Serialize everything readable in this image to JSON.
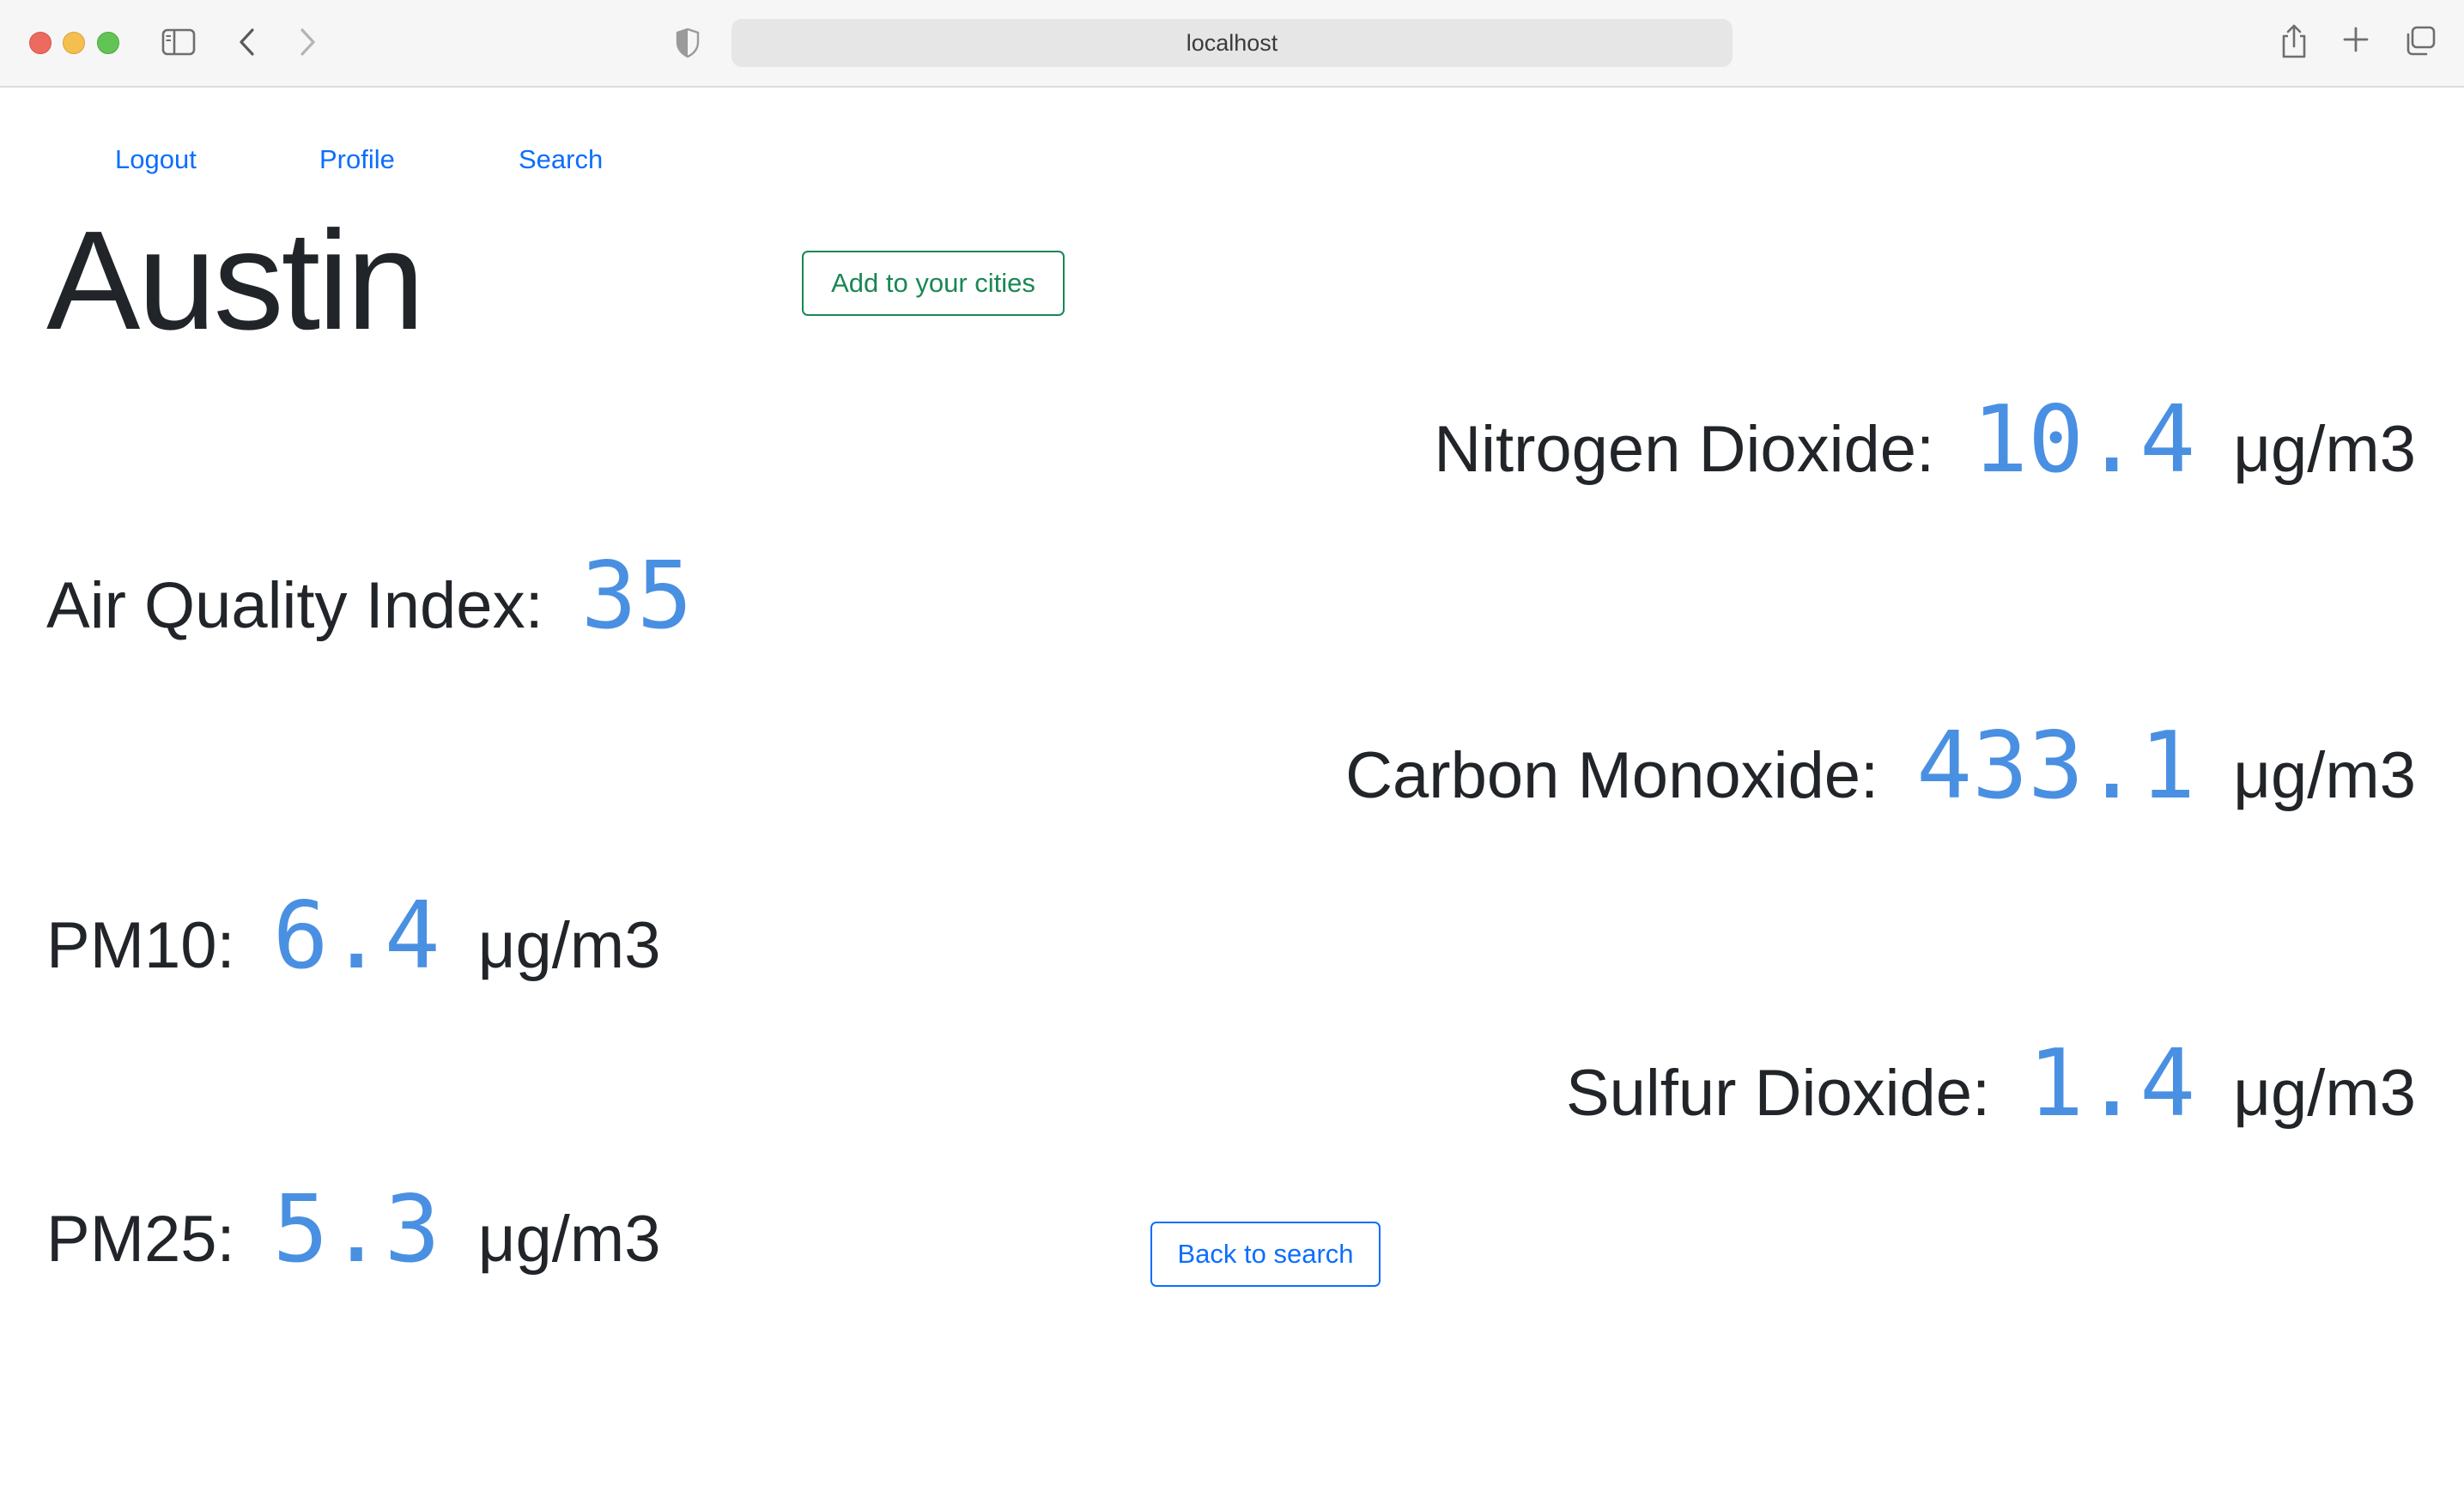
{
  "browser": {
    "url": "localhost"
  },
  "nav": {
    "logout": "Logout",
    "profile": "Profile",
    "search": "Search"
  },
  "city": {
    "name": "Austin",
    "add_button": "Add to your cities",
    "back_button": "Back to search"
  },
  "metrics": {
    "nitrogen_dioxide": {
      "label": "Nitrogen Dioxide:",
      "value": "10.4",
      "unit": "μg/m3"
    },
    "aqi": {
      "label": "Air Quality Index:",
      "value": "35"
    },
    "carbon_monoxide": {
      "label": "Carbon Monoxide:",
      "value": "433.1",
      "unit": "μg/m3"
    },
    "pm10": {
      "label": "PM10:",
      "value": "6.4",
      "unit": "μg/m3"
    },
    "sulfur_dioxide": {
      "label": "Sulfur Dioxide:",
      "value": "1.4",
      "unit": "μg/m3"
    },
    "pm25": {
      "label": "PM25:",
      "value": "5.3",
      "unit": "μg/m3"
    }
  },
  "colors": {
    "link": "#0d6efd",
    "value": "#4a90e2",
    "success": "#198754",
    "text": "#212529"
  }
}
